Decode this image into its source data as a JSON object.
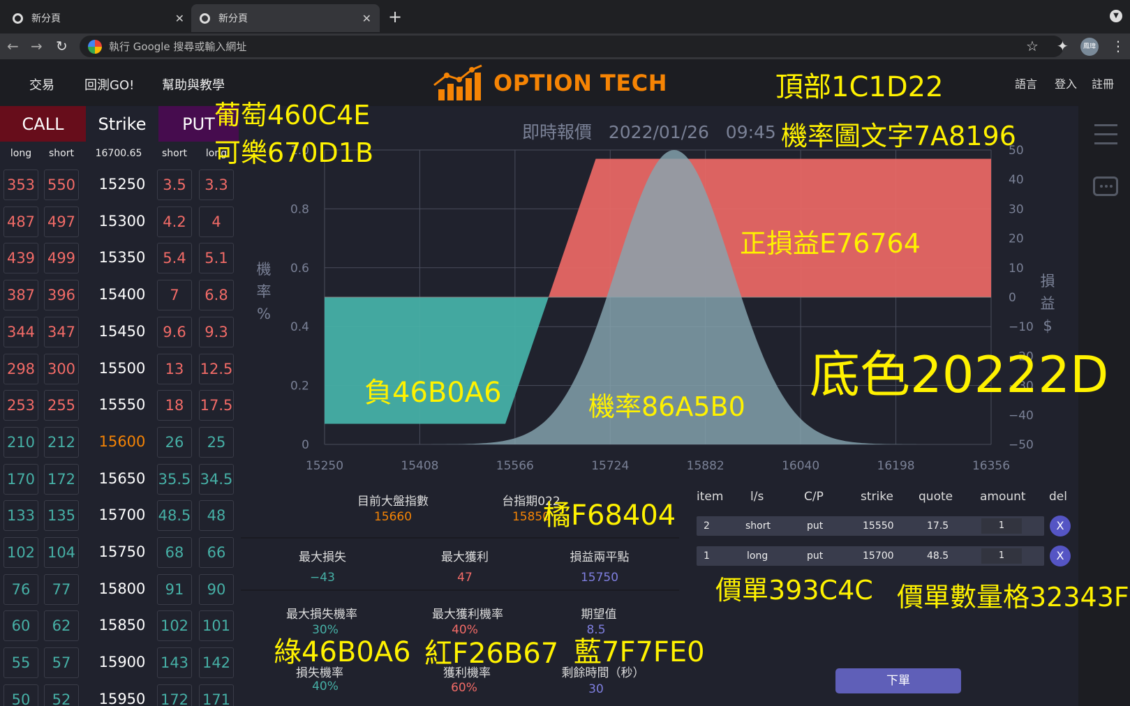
{
  "browser": {
    "tabs": [
      {
        "title": "新分頁"
      },
      {
        "title": "新分頁"
      }
    ],
    "omnibox_placeholder": "執行 Google 搜尋或輸入網址",
    "profile_label": "鳳瑋"
  },
  "nav": {
    "trade": "交易",
    "backtest": "回測GO!",
    "help": "幫助與教學"
  },
  "logo": {
    "text": "OPTION TECH"
  },
  "header_links": {
    "language": "語言",
    "login": "登入",
    "register": "註冊"
  },
  "chain": {
    "call_label": "CALL",
    "strike_label": "Strike",
    "put_label": "PUT",
    "sub_long": "long",
    "sub_short": "short",
    "underlying": "16700.65",
    "rows": [
      {
        "cl": "353",
        "cs": "550",
        "k": "15250",
        "ps": "3.5",
        "pl": "3.3",
        "cc": "red",
        "pc": "red",
        "kc": "white"
      },
      {
        "cl": "487",
        "cs": "497",
        "k": "15300",
        "ps": "4.2",
        "pl": "4",
        "cc": "red",
        "pc": "red",
        "kc": "white"
      },
      {
        "cl": "439",
        "cs": "499",
        "k": "15350",
        "ps": "5.4",
        "pl": "5.1",
        "cc": "red",
        "pc": "red",
        "kc": "white"
      },
      {
        "cl": "387",
        "cs": "396",
        "k": "15400",
        "ps": "7",
        "pl": "6.8",
        "cc": "red",
        "pc": "red",
        "kc": "white"
      },
      {
        "cl": "344",
        "cs": "347",
        "k": "15450",
        "ps": "9.6",
        "pl": "9.3",
        "cc": "red",
        "pc": "red",
        "kc": "white"
      },
      {
        "cl": "298",
        "cs": "300",
        "k": "15500",
        "ps": "13",
        "pl": "12.5",
        "cc": "red",
        "pc": "red",
        "kc": "white"
      },
      {
        "cl": "253",
        "cs": "255",
        "k": "15550",
        "ps": "18",
        "pl": "17.5",
        "cc": "red",
        "pc": "red",
        "kc": "white"
      },
      {
        "cl": "210",
        "cs": "212",
        "k": "15600",
        "ps": "26",
        "pl": "25",
        "cc": "green",
        "pc": "green",
        "kc": "orange"
      },
      {
        "cl": "170",
        "cs": "172",
        "k": "15650",
        "ps": "35.5",
        "pl": "34.5",
        "cc": "green",
        "pc": "green",
        "kc": "white"
      },
      {
        "cl": "133",
        "cs": "135",
        "k": "15700",
        "ps": "48.5",
        "pl": "48",
        "cc": "green",
        "pc": "green",
        "kc": "white"
      },
      {
        "cl": "102",
        "cs": "104",
        "k": "15750",
        "ps": "68",
        "pl": "66",
        "cc": "green",
        "pc": "green",
        "kc": "white"
      },
      {
        "cl": "76",
        "cs": "77",
        "k": "15800",
        "ps": "91",
        "pl": "90",
        "cc": "green",
        "pc": "green",
        "kc": "white"
      },
      {
        "cl": "60",
        "cs": "62",
        "k": "15850",
        "ps": "102",
        "pl": "101",
        "cc": "green",
        "pc": "green",
        "kc": "white"
      },
      {
        "cl": "55",
        "cs": "57",
        "k": "15900",
        "ps": "143",
        "pl": "142",
        "cc": "green",
        "pc": "green",
        "kc": "white"
      },
      {
        "cl": "50",
        "cs": "52",
        "k": "15950",
        "ps": "172",
        "pl": "171",
        "cc": "green",
        "pc": "green",
        "kc": "white"
      }
    ]
  },
  "chart_title": {
    "label": "即時報價",
    "date": "2022/01/26",
    "time": "09:45"
  },
  "chart_data": {
    "type": "area",
    "x_ticks": [
      "15250",
      "15408",
      "15566",
      "15724",
      "15882",
      "16040",
      "16198",
      "16356"
    ],
    "xlim": [
      15250,
      16356
    ],
    "ylabel_left": [
      "機",
      "率",
      "%"
    ],
    "ylabel_right": [
      "損",
      "益",
      "$"
    ],
    "y_left_ticks": [
      "0",
      "0.2",
      "0.4",
      "0.6",
      "0.8",
      "1.0"
    ],
    "ylim_left": [
      0,
      1.0
    ],
    "y_right_ticks": [
      "50",
      "40",
      "30",
      "20",
      "10",
      "0",
      "−10",
      "−20",
      "−30",
      "−40",
      "−50"
    ],
    "ylim_right": [
      -50,
      50
    ],
    "probability": {
      "mean": 15830,
      "sd": 95,
      "peak": 1.0
    },
    "payoff": [
      [
        15250,
        -43
      ],
      [
        15550,
        -43
      ],
      [
        15700,
        47
      ],
      [
        16356,
        47
      ]
    ],
    "colors": {
      "positive": "#E76764",
      "negative": "#46B0A6",
      "probability": "#86A5B0",
      "text": "#7A8196"
    }
  },
  "info": {
    "index_label": "目前大盤指數",
    "index_value": "15660",
    "future_label": "台指期022",
    "future_value": "15850",
    "maxloss_label": "最大損失",
    "maxloss_value": "−43",
    "maxprofit_label": "最大獲利",
    "maxprofit_value": "47",
    "breakeven_label": "損益兩平點",
    "breakeven_value": "15750",
    "maxlossprob_label": "最大損失機率",
    "maxlossprob_value": "30%",
    "maxprofitprob_label": "最大獲利機率",
    "maxprofitprob_value": "40%",
    "expect_label": "期望值",
    "expect_value": "8.5",
    "lossprob_label": "損失機率",
    "lossprob_value": "40%",
    "profitprob_label": "獲利機率",
    "profitprob_value": "60%",
    "remain_label": "剩餘時間（秒）",
    "remain_value": "30"
  },
  "order": {
    "headers": {
      "item": "item",
      "ls": "l/s",
      "cp": "C/P",
      "strike": "strike",
      "quote": "quote",
      "amount": "amount",
      "del": "del"
    },
    "rows": [
      {
        "item": "2",
        "ls": "short",
        "cp": "put",
        "strike": "15550",
        "quote": "17.5",
        "amount": "1",
        "del": "X"
      },
      {
        "item": "1",
        "ls": "long",
        "cp": "put",
        "strike": "15700",
        "quote": "48.5",
        "amount": "1",
        "del": "X"
      }
    ],
    "submit": "下單"
  },
  "annotations": {
    "top": "頂部1C1D22",
    "grape": "葡萄460C4E",
    "cola": "可樂670D1B",
    "chart_text": "機率圖文字7A8196",
    "positive": "正損益E76764",
    "negative": "負46B0A6",
    "prob": "機率86A5B0",
    "bg": "底色20222D",
    "orange": "橘F68404",
    "order_row": "價單393C4C",
    "order_qty": "價單數量格32343F",
    "green": "綠46B0A6",
    "red": "紅F26B67",
    "blue": "藍7F7FE0"
  }
}
